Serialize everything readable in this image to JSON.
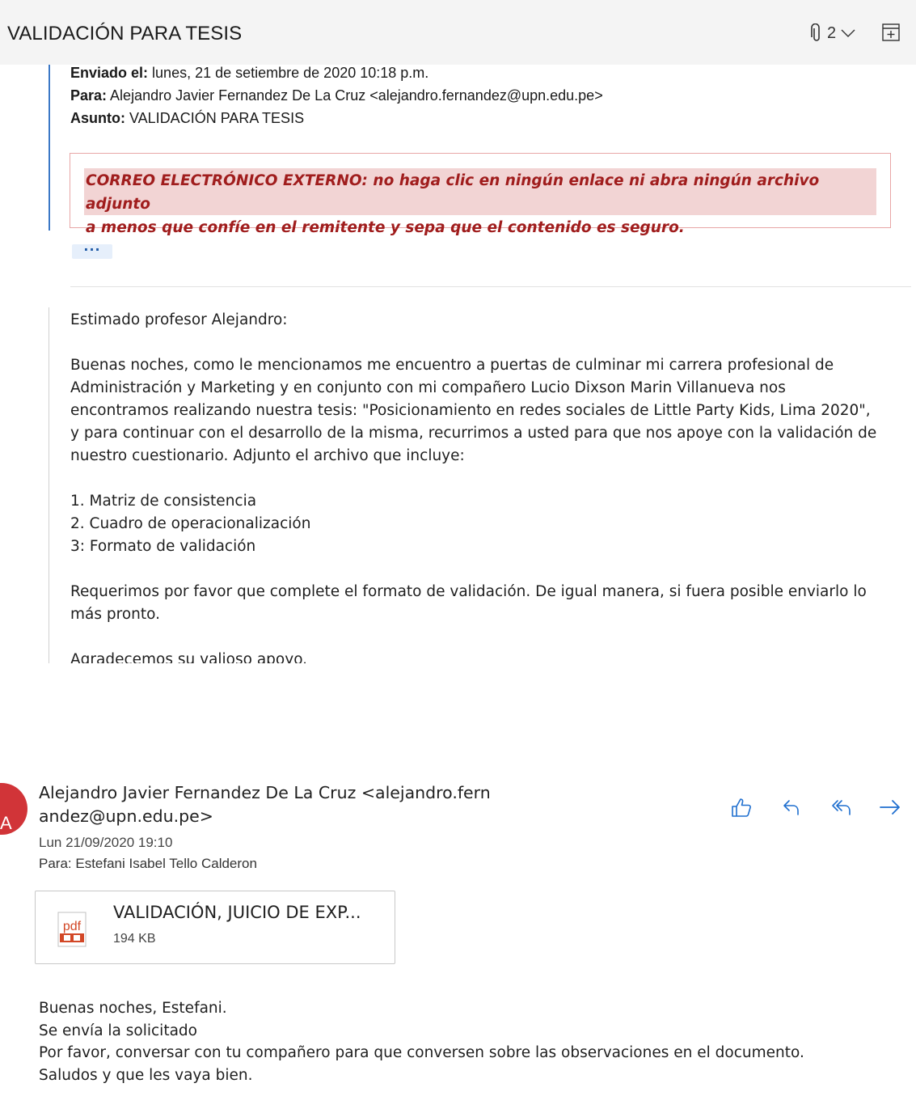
{
  "header": {
    "subject": "VALIDACIÓN PARA TESIS",
    "attachment_count": "2",
    "paperclip_icon": "paperclip-icon",
    "chevron_icon": "chevron-down-icon",
    "expand_icon": "expand-icon"
  },
  "quoted_header": {
    "sent_label": "Enviado el:",
    "sent_value": "lunes, 21 de setiembre de 2020 10:18 p.m.",
    "to_label": "Para:",
    "to_value": "Alejandro Javier Fernandez De La Cruz <alejandro.fernandez@upn.edu.pe>",
    "subject_label": "Asunto:",
    "subject_value": "VALIDACIÓN PARA TESIS",
    "warning_line1": "CORREO ELECTRÓNICO EXTERNO: no haga clic en ningún enlace ni abra ningún archivo adjunto",
    "warning_line2": "a menos que confíe en el remitente y sepa que el contenido es seguro.",
    "ellipsis": "···"
  },
  "quoted_body": {
    "greeting": "Estimado profesor Alejandro:",
    "p1": [
      "Buenas noches, como le mencionamos me encuentro a puertas de culminar mi carrera profesional de",
      "Administración y Marketing y en conjunto con mi compañero Lucio Dixson Marin Villanueva nos",
      "encontramos realizando nuestra tesis: \"Posicionamiento en redes sociales de Little Party Kids, Lima 2020\",",
      "y para continuar con el desarrollo de la misma, recurrimos a usted para que nos apoye con la validación de",
      "nuestro cuestionario. Adjunto el archivo que incluye:"
    ],
    "list": [
      "1. Matriz de consistencia",
      "2. Cuadro de operacionalización",
      "3: Formato de validación"
    ],
    "p2": [
      "Requerimos por favor que complete el formato de validación. De igual manera, si fuera posible enviarlo lo",
      "más pronto."
    ],
    "closing": "Agradecemos su valioso apoyo."
  },
  "reply": {
    "avatar_initial": "A",
    "avatar_color": "#d13438",
    "sender_line1": "Alejandro Javier Fernandez De La Cruz <alejandro.fern",
    "sender_line2": "andez@upn.edu.pe>",
    "date": "Lun 21/09/2020 19:10",
    "to": "Para:  Estefani Isabel Tello Calderon",
    "actions": [
      "like-icon",
      "reply-icon",
      "reply-all-icon",
      "forward-icon"
    ],
    "attachment": {
      "name": "VALIDACIÓN, JUICIO DE EXP...",
      "size": "194 KB",
      "icon_label": "pdf"
    },
    "body": [
      "Buenas noches, Estefani.",
      "Se envía la solicitado",
      "Por favor, conversar con tu compañero para que conversen sobre las observaciones en el documento.",
      "Saludos y que les vaya bien."
    ]
  },
  "colors": {
    "accent": "#1f6fcf",
    "warning_text": "#a01d1d",
    "warning_bg": "#f2d4d4",
    "quote_bar": "#3b78c6"
  }
}
